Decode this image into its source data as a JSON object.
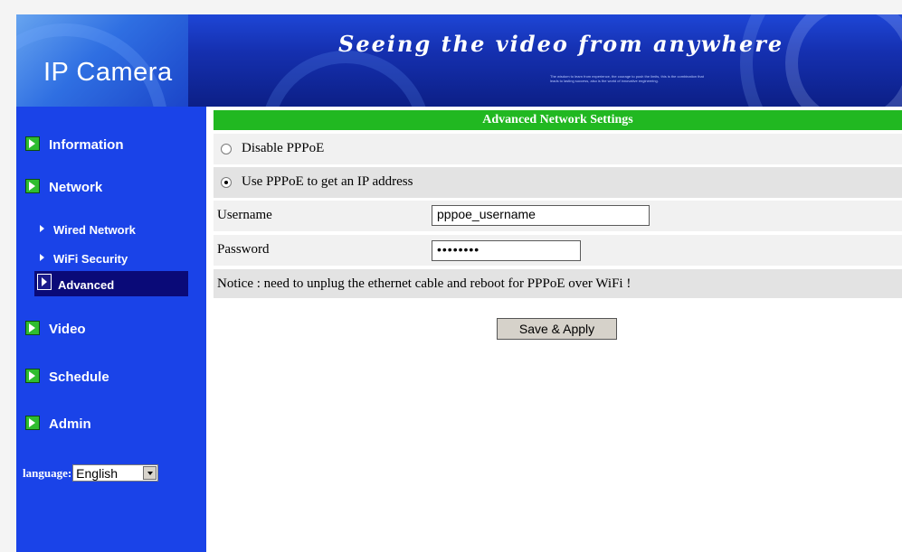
{
  "banner": {
    "title": "IP Camera",
    "tagline": "Seeing the video from anywhere",
    "fine_print": "The wisdom to learn from experience, the courage to push the limits, this is the combination that leads to lasting success, also is the world of innovative engineering."
  },
  "sidebar": {
    "items": [
      {
        "label": "Information"
      },
      {
        "label": "Network"
      },
      {
        "label": "Video"
      },
      {
        "label": "Schedule"
      },
      {
        "label": "Admin"
      }
    ],
    "sub_items": [
      {
        "label": "Wired Network"
      },
      {
        "label": "WiFi Security"
      },
      {
        "label": "Advanced"
      }
    ],
    "language": {
      "label": "language:",
      "selected": "English"
    }
  },
  "main": {
    "header": "Advanced Network Settings",
    "options": {
      "disable": "Disable PPPoE",
      "use": "Use PPPoE to get an IP address",
      "selected": "use"
    },
    "username": {
      "label": "Username",
      "value": "pppoe_username"
    },
    "password": {
      "label": "Password",
      "value": "••••••••"
    },
    "notice": "Notice : need to unplug the ethernet cable and reboot for PPPoE over WiFi !",
    "save_label": "Save & Apply"
  },
  "colors": {
    "sidebar": "#1a43e8",
    "header_green": "#21b821",
    "active_item": "#0a0a78"
  },
  "icons": [
    "green-arrow-icon",
    "white-triangle-icon",
    "radio-icon",
    "dropdown-arrow-icon"
  ]
}
